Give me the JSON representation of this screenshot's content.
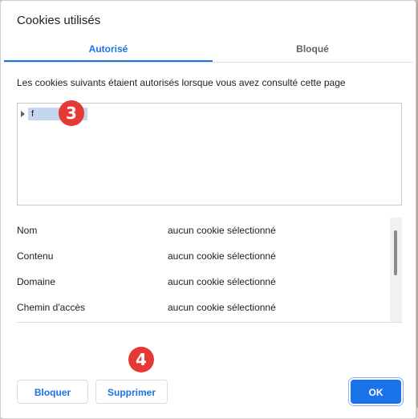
{
  "dialog": {
    "title": "Cookies utilisés",
    "tabs": [
      {
        "label": "Autorisé",
        "active": true
      },
      {
        "label": "Bloqué",
        "active": false
      }
    ],
    "description": "Les cookies suivants étaient autorisés lorsque vous avez consulté cette page",
    "tree": {
      "items": [
        {
          "label": "f"
        }
      ]
    },
    "details": [
      {
        "key": "Nom",
        "value": "aucun cookie sélectionné"
      },
      {
        "key": "Contenu",
        "value": "aucun cookie sélectionné"
      },
      {
        "key": "Domaine",
        "value": "aucun cookie sélectionné"
      },
      {
        "key": "Chemin d'accès",
        "value": "aucun cookie sélectionné"
      }
    ],
    "buttons": {
      "block": "Bloquer",
      "delete": "Supprimer",
      "ok": "OK"
    }
  },
  "annotations": {
    "step_3": "3",
    "step_4": "4"
  },
  "colors": {
    "accent": "#1a73e8",
    "badge": "#e53935",
    "selection": "#c6d6ef"
  }
}
